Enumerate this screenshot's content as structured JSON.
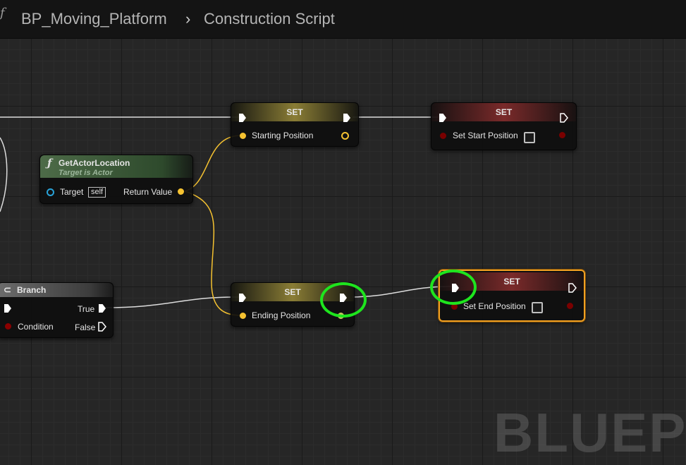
{
  "breadcrumb": {
    "blueprint": "BP_Moving_Platform",
    "separator": "›",
    "graph": "Construction Script"
  },
  "nodes": {
    "set_starting": {
      "title": "SET",
      "variable": "Starting Position"
    },
    "set_start_position": {
      "title": "SET",
      "variable": "Set Start Position"
    },
    "get_actor_location": {
      "title": "GetActorLocation",
      "subtitle": "Target is Actor",
      "target_label": "Target",
      "target_value": "self",
      "return_label": "Return Value"
    },
    "branch": {
      "title": "Branch",
      "true_label": "True",
      "condition_label": "Condition",
      "false_label": "False"
    },
    "set_ending": {
      "title": "SET",
      "variable": "Ending Position"
    },
    "set_end_position": {
      "title": "SET",
      "variable": "Set End Position"
    }
  },
  "watermark": "BLUEPRI",
  "colors": {
    "vector_pin": "#f5c231",
    "bool_pin": "#8b0000",
    "object_pin": "#29a3d8",
    "exec_wire": "#e6e6e6",
    "annotation": "#1ee51e",
    "selection": "#f0a022"
  }
}
